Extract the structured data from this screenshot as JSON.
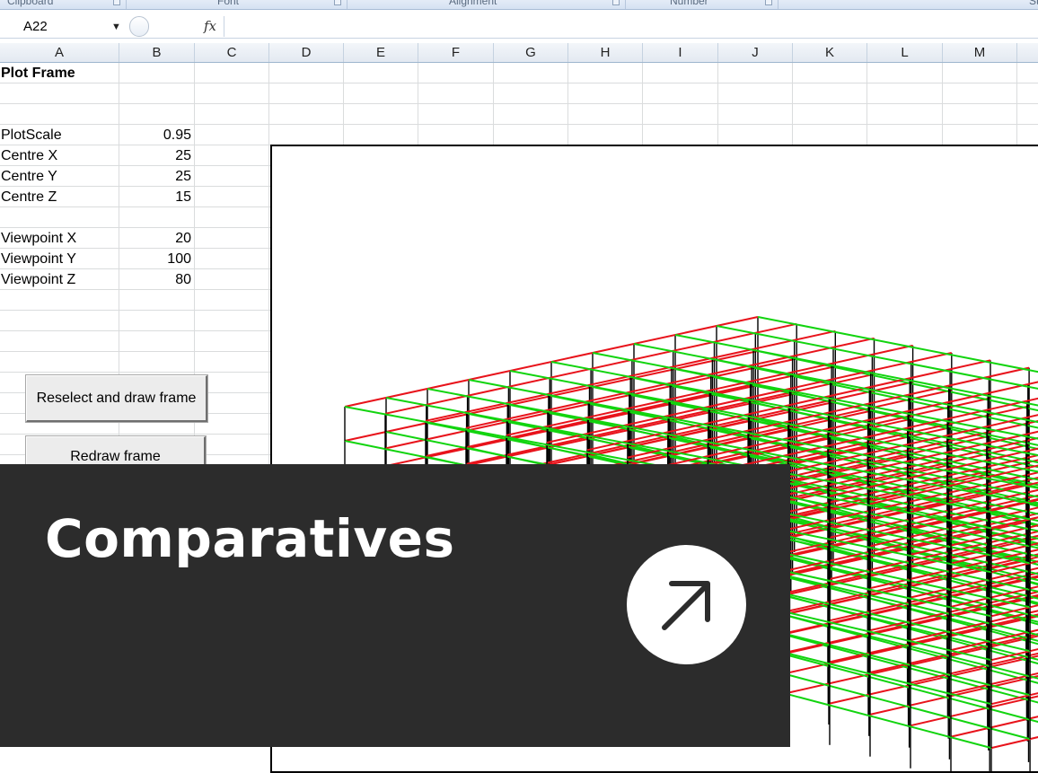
{
  "ribbon": {
    "groups": [
      {
        "label": "Clipboard"
      },
      {
        "label": "Font"
      },
      {
        "label": "Alignment"
      },
      {
        "label": "Number"
      },
      {
        "label": "St"
      }
    ]
  },
  "formula_bar": {
    "name_box": "A22",
    "fx": "fx",
    "formula": ""
  },
  "columns": [
    "A",
    "B",
    "C",
    "D",
    "E",
    "F",
    "G",
    "H",
    "I",
    "J",
    "K",
    "L",
    "M"
  ],
  "sheet": {
    "title": "Plot Frame",
    "params": [
      {
        "label": "PlotScale",
        "value": "0.95"
      },
      {
        "label": "Centre X",
        "value": "25"
      },
      {
        "label": "Centre Y",
        "value": "25"
      },
      {
        "label": "Centre Z",
        "value": "15"
      },
      {
        "label": "Viewpoint X",
        "value": "20"
      },
      {
        "label": "Viewpoint Y",
        "value": "100"
      },
      {
        "label": "Viewpoint Z",
        "value": "80"
      }
    ]
  },
  "buttons": {
    "reselect_label": "Reselect and draw frame",
    "redraw_label": "Redraw frame"
  },
  "plot": {
    "beam_x_color": "#e8131b",
    "beam_y_color": "#12d40f",
    "column_color": "#000000"
  },
  "overlay": {
    "title": "Comparatives",
    "link_icon": "arrow-up-right-icon"
  }
}
